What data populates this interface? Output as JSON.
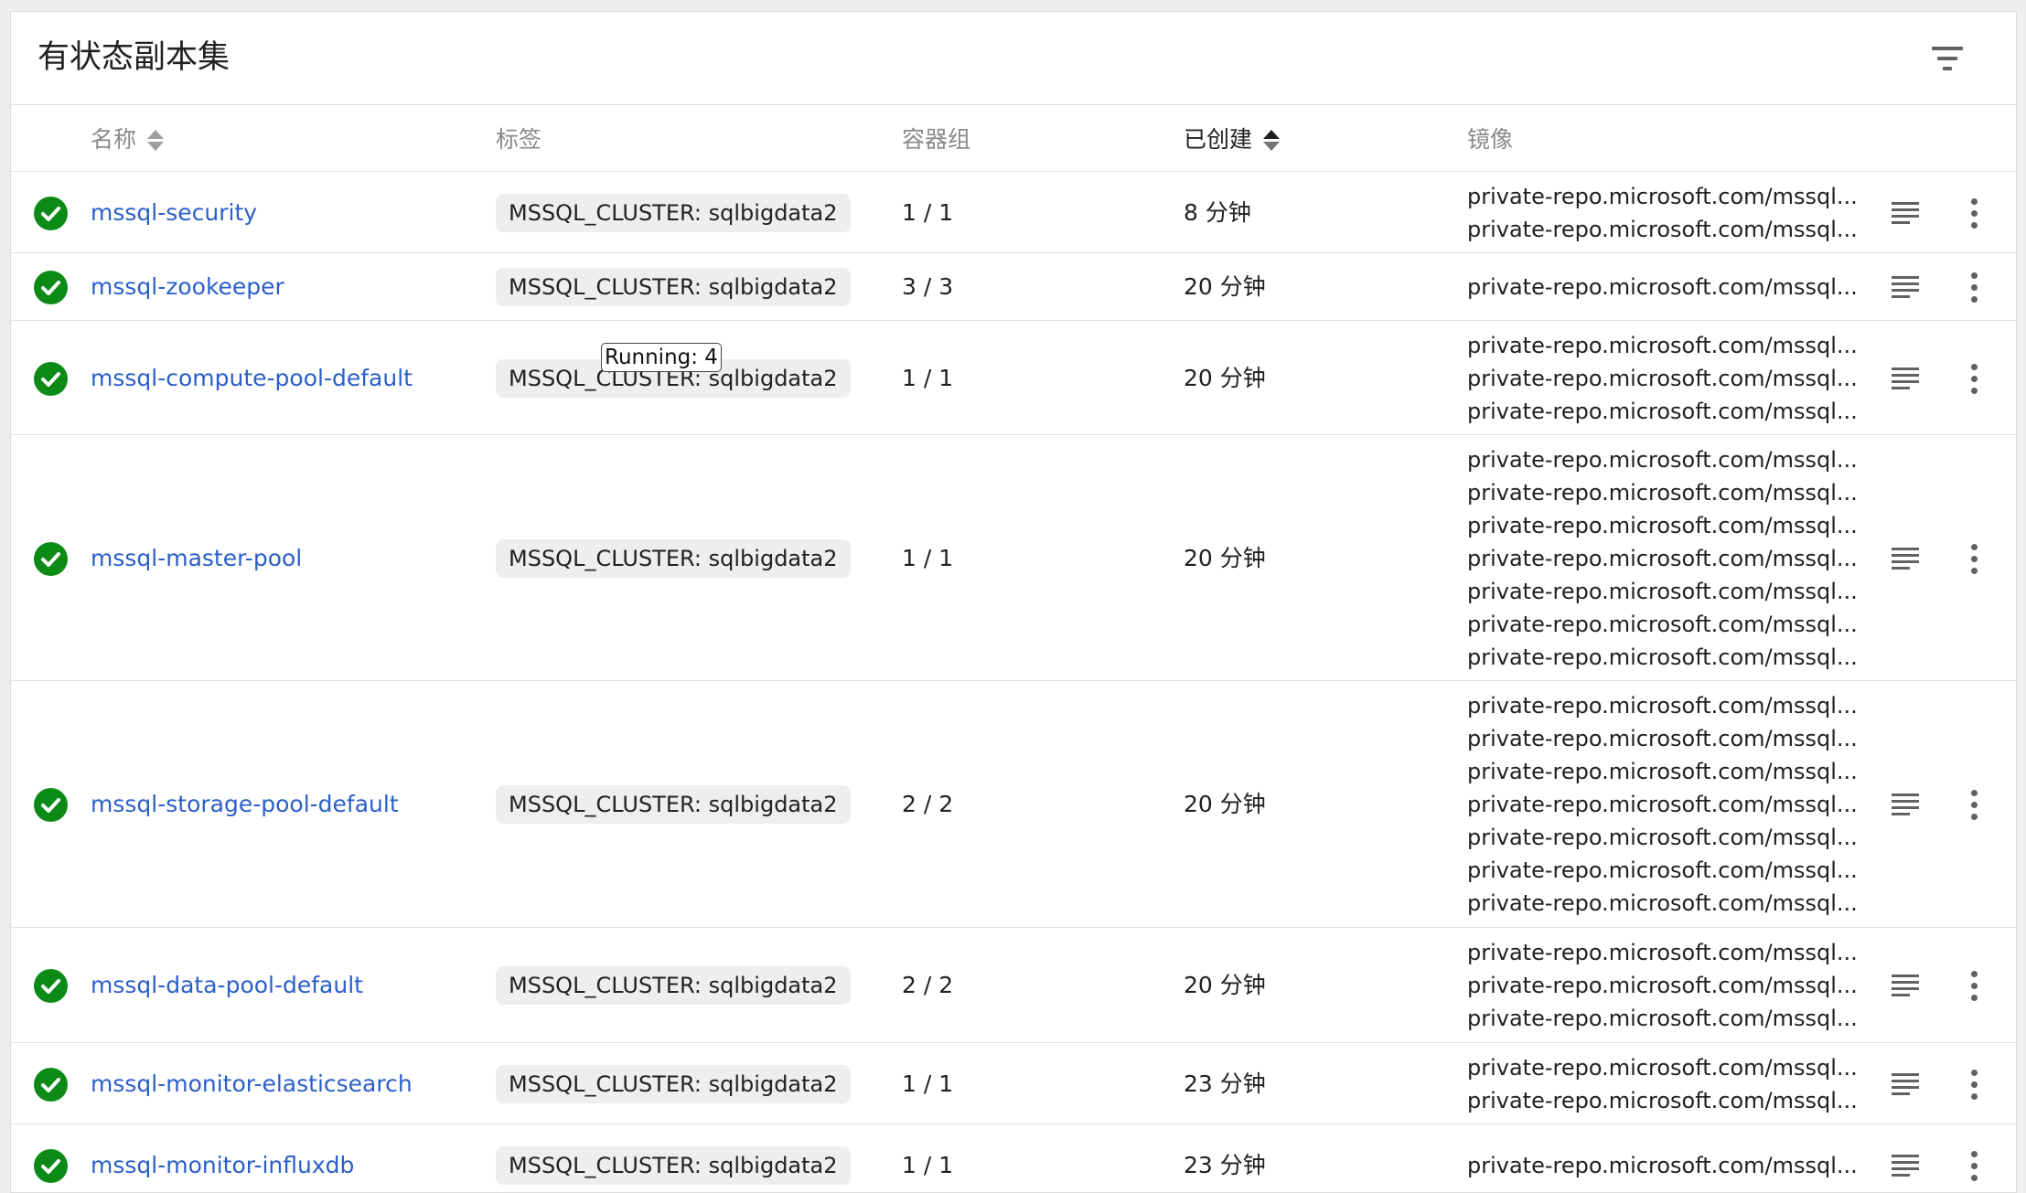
{
  "title": "有状态副本集",
  "columns": {
    "name": "名称",
    "labels": "标签",
    "pods": "容器组",
    "created": "已创建",
    "images": "镜像"
  },
  "tooltip": "Running: 4",
  "rows": [
    {
      "name": "mssql-security",
      "label": "MSSQL_CLUSTER: sqlbigdata2",
      "pods": "1 / 1",
      "created": "8 分钟",
      "images": [
        "private-repo.microsoft.com/mssql...",
        "private-repo.microsoft.com/mssql..."
      ]
    },
    {
      "name": "mssql-zookeeper",
      "label": "MSSQL_CLUSTER: sqlbigdata2",
      "pods": "3 / 3",
      "created": "20 分钟",
      "images": [
        "private-repo.microsoft.com/mssql..."
      ]
    },
    {
      "name": "mssql-compute-pool-default",
      "label": "MSSQL_CLUSTER: sqlbigdata2",
      "pods": "1 / 1",
      "created": "20 分钟",
      "images": [
        "private-repo.microsoft.com/mssql...",
        "private-repo.microsoft.com/mssql...",
        "private-repo.microsoft.com/mssql..."
      ]
    },
    {
      "name": "mssql-master-pool",
      "label": "MSSQL_CLUSTER: sqlbigdata2",
      "pods": "1 / 1",
      "created": "20 分钟",
      "images": [
        "private-repo.microsoft.com/mssql...",
        "private-repo.microsoft.com/mssql...",
        "private-repo.microsoft.com/mssql...",
        "private-repo.microsoft.com/mssql...",
        "private-repo.microsoft.com/mssql...",
        "private-repo.microsoft.com/mssql...",
        "private-repo.microsoft.com/mssql..."
      ]
    },
    {
      "name": "mssql-storage-pool-default",
      "label": "MSSQL_CLUSTER: sqlbigdata2",
      "pods": "2 / 2",
      "created": "20 分钟",
      "images": [
        "private-repo.microsoft.com/mssql...",
        "private-repo.microsoft.com/mssql...",
        "private-repo.microsoft.com/mssql...",
        "private-repo.microsoft.com/mssql...",
        "private-repo.microsoft.com/mssql...",
        "private-repo.microsoft.com/mssql...",
        "private-repo.microsoft.com/mssql..."
      ]
    },
    {
      "name": "mssql-data-pool-default",
      "label": "MSSQL_CLUSTER: sqlbigdata2",
      "pods": "2 / 2",
      "created": "20 分钟",
      "images": [
        "private-repo.microsoft.com/mssql...",
        "private-repo.microsoft.com/mssql...",
        "private-repo.microsoft.com/mssql..."
      ]
    },
    {
      "name": "mssql-monitor-elasticsearch",
      "label": "MSSQL_CLUSTER: sqlbigdata2",
      "pods": "1 / 1",
      "created": "23 分钟",
      "images": [
        "private-repo.microsoft.com/mssql...",
        "private-repo.microsoft.com/mssql..."
      ]
    },
    {
      "name": "mssql-monitor-influxdb",
      "label": "MSSQL_CLUSTER: sqlbigdata2",
      "pods": "1 / 1",
      "created": "23 分钟",
      "images": [
        "private-repo.microsoft.com/mssql..."
      ]
    }
  ],
  "icons": {
    "status": "check-circle-icon",
    "logs": "logs-icon",
    "more": "more-vert-icon",
    "filter": "filter-icon"
  },
  "colors": {
    "link": "#2a5fc9",
    "success": "#0b8a16",
    "chip": "#eeeeee"
  }
}
